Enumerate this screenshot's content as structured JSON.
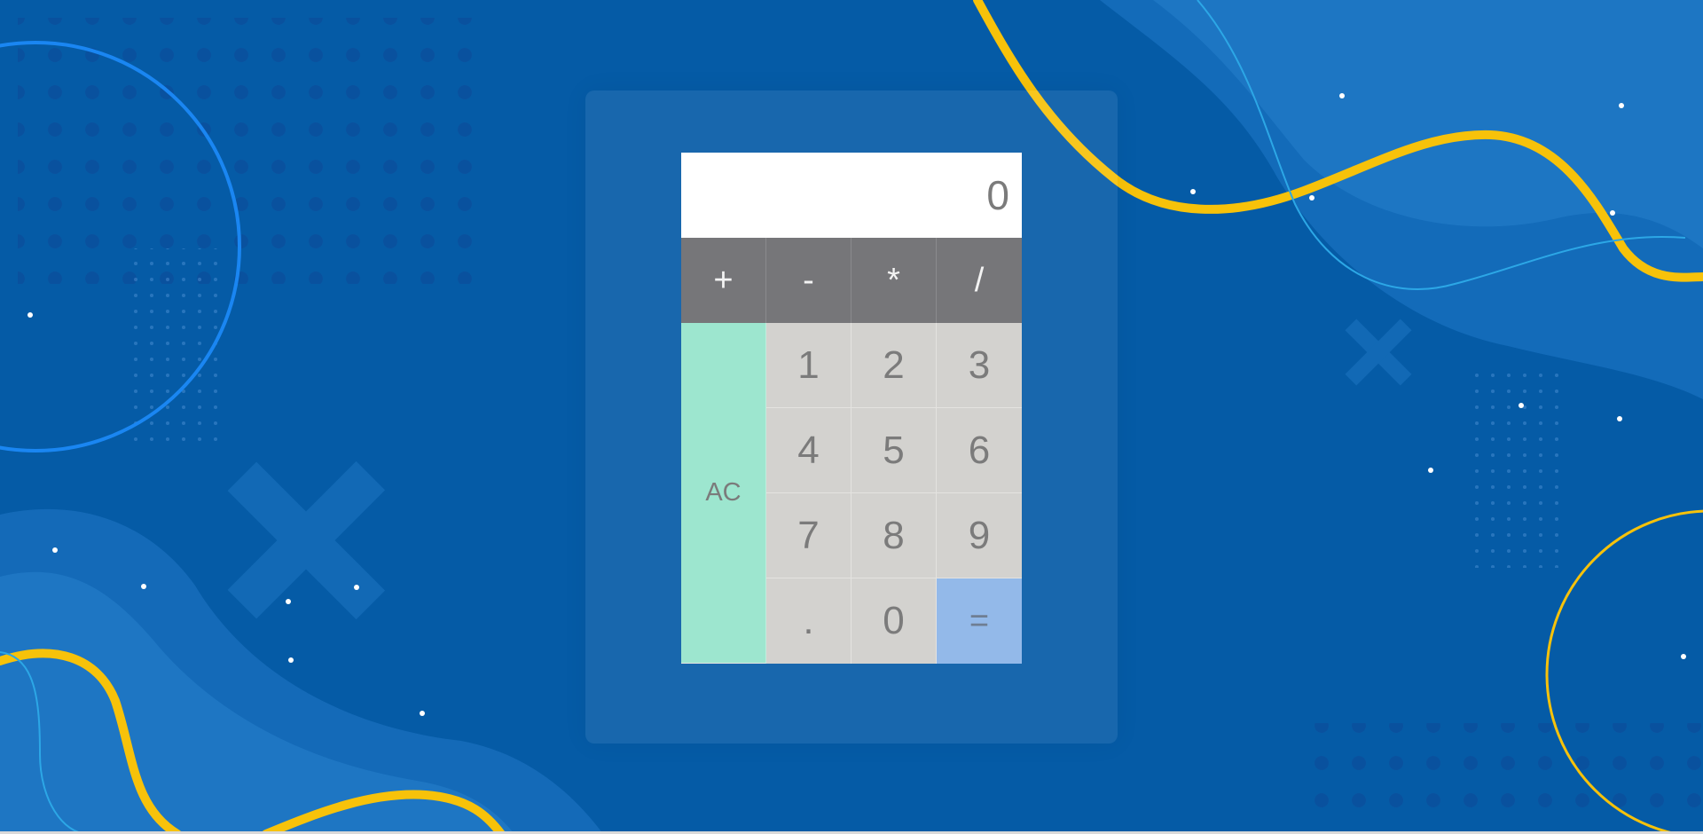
{
  "calculator": {
    "display_value": "0",
    "operators": [
      "+",
      "-",
      "*",
      "/"
    ],
    "clear_label": "AC",
    "digits": [
      "1",
      "2",
      "3",
      "4",
      "5",
      "6",
      "7",
      "8",
      "9",
      "0"
    ],
    "decimal_label": ".",
    "equals_label": "="
  },
  "colors": {
    "background": "#055ba6",
    "display": "#ffffff",
    "operator_key": "#767679",
    "number_key": "#d3d2cf",
    "clear_key": "#9de6cf",
    "equals_key": "#93b9e9",
    "accent_yellow": "#f7c20a"
  }
}
